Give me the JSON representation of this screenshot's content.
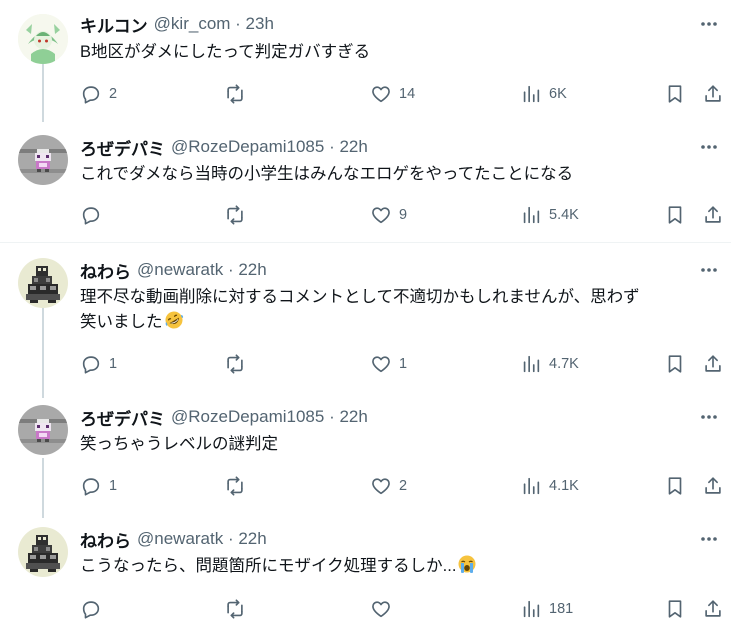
{
  "tweets": [
    {
      "name": "キルコン",
      "handle": "@kir_com · 23h",
      "lines": [
        "B地区がダメにしたって判定ガバすぎる"
      ],
      "replies": "2",
      "likes": "14",
      "views": "6K",
      "avatar": "green-character"
    },
    {
      "name": "ろぜデパミ",
      "handle": "@RozeDepami1085 · 22h",
      "lines": [
        "これでダメなら当時の小学生はみんなエロゲをやってたことになる"
      ],
      "replies": "",
      "likes": "9",
      "views": "5.4K",
      "avatar": "pixel-sprite"
    },
    {
      "name": "ねわら",
      "handle": "@newaratk · 22h",
      "lines": [
        "理不尽な動画削除に対するコメントとして不適切かもしれませんが、思わず",
        "笑いました"
      ],
      "emoji": "rolling-on-floor-laughing",
      "replies": "1",
      "likes": "1",
      "views": "4.7K",
      "avatar": "pixel-creature"
    },
    {
      "name": "ろぜデパミ",
      "handle": "@RozeDepami1085 · 22h",
      "lines": [
        "笑っちゃうレベルの謎判定"
      ],
      "replies": "1",
      "likes": "2",
      "views": "4.1K",
      "avatar": "pixel-sprite"
    },
    {
      "name": "ねわら",
      "handle": "@newaratk · 22h",
      "lines": [
        "こうなったら、問題箇所にモザイク処理するしか..."
      ],
      "emoji": "crying-face",
      "replies": "",
      "likes": "",
      "views": "181",
      "avatar": "pixel-creature"
    }
  ],
  "colors": {
    "text": "#0f1419",
    "secondary": "#536471",
    "line": "#cfd9de",
    "divider": "#eff3f4"
  }
}
